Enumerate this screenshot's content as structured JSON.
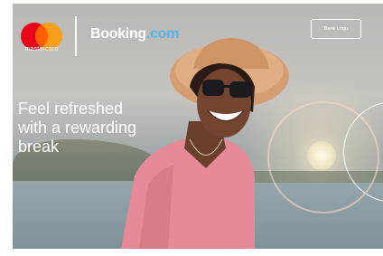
{
  "brand": {
    "mastercard_wordmark": "mastercard",
    "booking_name": "Booking",
    "booking_tld": ".com",
    "booking_tld_color": "#53b5ee",
    "mastercard_red": "#eb001b",
    "mastercard_orange": "#f79e1b",
    "mastercard_overlap": "#ff5f00"
  },
  "bank_logo": {
    "label": "Bank Logo"
  },
  "headline": {
    "lines": [
      "Feel refreshed",
      "with a rewarding",
      "break"
    ]
  }
}
